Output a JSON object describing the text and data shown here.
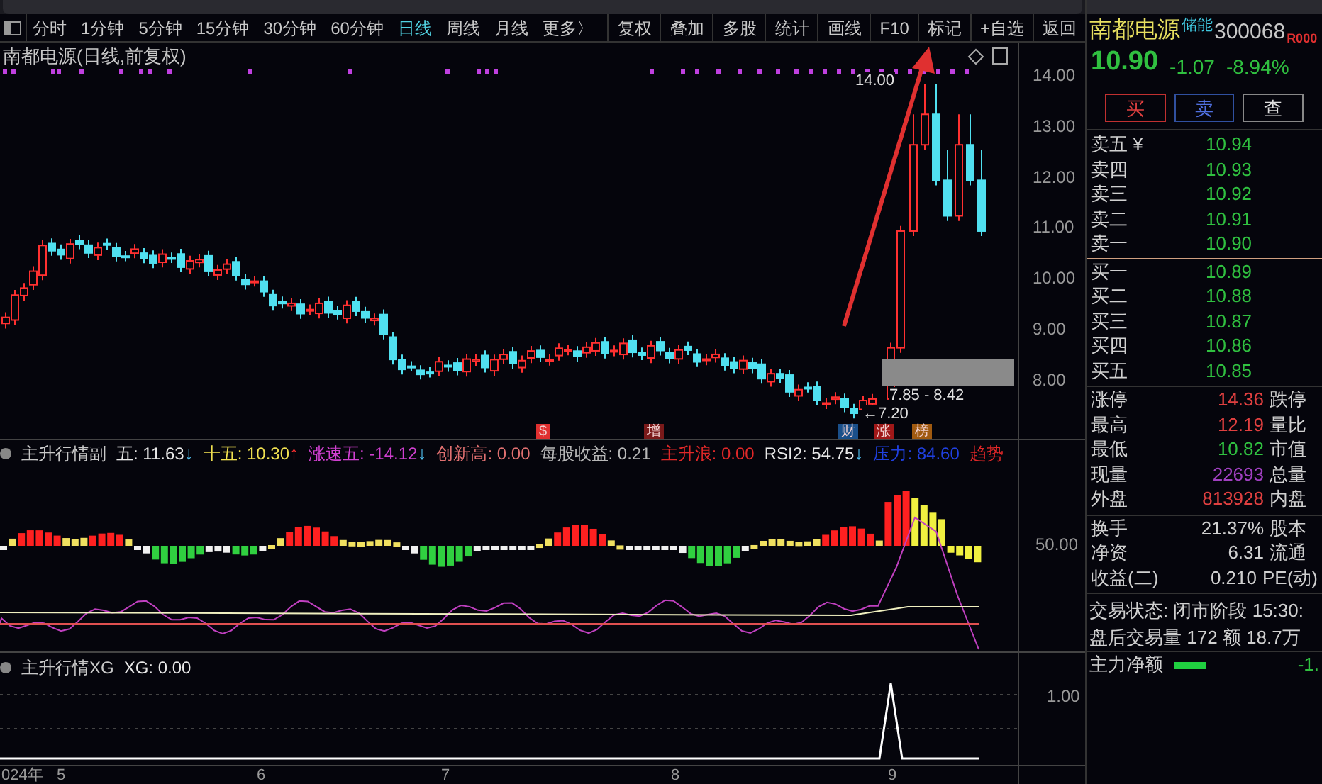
{
  "periods": [
    {
      "label": "分时",
      "selected": false
    },
    {
      "label": "1分钟",
      "selected": false
    },
    {
      "label": "5分钟",
      "selected": false
    },
    {
      "label": "15分钟",
      "selected": false
    },
    {
      "label": "30分钟",
      "selected": false
    },
    {
      "label": "60分钟",
      "selected": false
    },
    {
      "label": "日线",
      "selected": true
    },
    {
      "label": "周线",
      "selected": false
    },
    {
      "label": "月线",
      "selected": false
    },
    {
      "label": "更多〉",
      "selected": false
    }
  ],
  "toolbar_buttons": [
    "复权",
    "叠加",
    "多股",
    "统计",
    "画线",
    "F10",
    "标记",
    "+自选",
    "返回"
  ],
  "main_chart": {
    "title": "南都电源(日线,前复权)",
    "price_axis": [
      "14.00",
      "13.00",
      "12.00",
      "11.00",
      "10.00",
      "9.00",
      "8.00"
    ],
    "annotations": [
      {
        "kind": "high",
        "text": "14.00"
      },
      {
        "kind": "range",
        "text": "7.85 - 8.42"
      },
      {
        "kind": "low",
        "text": "←7.20"
      }
    ],
    "events": [
      {
        "text": "$",
        "color": "#e03030"
      },
      {
        "text": "增",
        "color": "#7a1a1a"
      },
      {
        "text": "财",
        "color": "#1a4f8a"
      },
      {
        "text": "涨",
        "color": "#a01818"
      },
      {
        "text": "榜",
        "color": "#a05a10"
      }
    ]
  },
  "indicator_1": {
    "legend": [
      {
        "text": "主升行情副",
        "color": "#c8c8c8"
      },
      {
        "text": "五: 11.63",
        "color": "#e8e8e8",
        "arrow": {
          "text": "↓",
          "color": "#50c0f0"
        }
      },
      {
        "text": "十五: 10.30",
        "color": "#f0e050",
        "arrow": {
          "text": "↑",
          "color": "#ff3030"
        }
      },
      {
        "text": "涨速五: -14.12",
        "color": "#d040d0",
        "arrow": {
          "text": "↓",
          "color": "#50c0f0"
        }
      },
      {
        "text": "创新高: 0.00",
        "color": "#e07070"
      },
      {
        "text": "每股收益: 0.21",
        "color": "#b8b8b8"
      },
      {
        "text": "主升浪: 0.00",
        "color": "#e02828"
      },
      {
        "text": "RSI2: 54.75",
        "color": "#e8e8e8",
        "arrow": {
          "text": "↓",
          "color": "#50c0f0"
        }
      },
      {
        "text": "压力: 84.60",
        "color": "#2040e0"
      },
      {
        "text": "趋势",
        "color": "#e02828"
      }
    ],
    "axis_label": "50.00"
  },
  "indicator_2": {
    "legend": [
      {
        "text": "主升行情XG",
        "color": "#c8c8c8"
      },
      {
        "text": "XG: 0.00",
        "color": "#e8e8e8"
      }
    ],
    "axis_label": "1.00"
  },
  "date_axis": [
    "024年",
    "5",
    "6",
    "7",
    "8",
    "9"
  ],
  "quote": {
    "name": "南都电源",
    "tag": "储能",
    "code": "300068",
    "badge": "R000",
    "price": "10.90",
    "change": "-1.07",
    "percent": "-8.94%"
  },
  "trade_buttons": [
    {
      "label": "买",
      "kind": "buy"
    },
    {
      "label": "卖",
      "kind": "sell"
    },
    {
      "label": "查",
      "kind": "query"
    }
  ],
  "asks": [
    {
      "label": "卖五 ¥",
      "price": "10.94"
    },
    {
      "label": "卖四",
      "price": "10.93"
    },
    {
      "label": "卖三",
      "price": "10.92"
    },
    {
      "label": "卖二",
      "price": "10.91"
    },
    {
      "label": "卖一",
      "price": "10.90"
    }
  ],
  "bids": [
    {
      "label": "买一",
      "price": "10.89"
    },
    {
      "label": "买二",
      "price": "10.88"
    },
    {
      "label": "买三",
      "price": "10.87"
    },
    {
      "label": "买四",
      "price": "10.86"
    },
    {
      "label": "买五",
      "price": "10.85"
    }
  ],
  "stats": [
    {
      "label": "涨停",
      "value": "14.36",
      "color": "#e04040",
      "label_2": "跌停"
    },
    {
      "label": "最高",
      "value": "12.19",
      "color": "#e04040",
      "label_2": "量比"
    },
    {
      "label": "最低",
      "value": "10.82",
      "color": "#30c040",
      "label_2": "市值"
    },
    {
      "label": "现量",
      "value": "22693",
      "color": "#a040c0",
      "label_2": "总量"
    },
    {
      "label": "外盘",
      "value": "813928",
      "color": "#e04040",
      "label_2": "内盘"
    }
  ],
  "stats_2": [
    {
      "label": "换手",
      "value": "21.37%",
      "label_2": "股本"
    },
    {
      "label": "净资",
      "value": "6.31",
      "label_2": "流通"
    },
    {
      "label": "收益(二)",
      "value": "0.210",
      "label_2": "PE(动)"
    }
  ],
  "status_lines": [
    "交易状态: 闭市阶段 15:30:",
    "盘后交易量 172 额 18.7万"
  ],
  "main_force": {
    "label": "主力净额",
    "value": "-1."
  }
}
